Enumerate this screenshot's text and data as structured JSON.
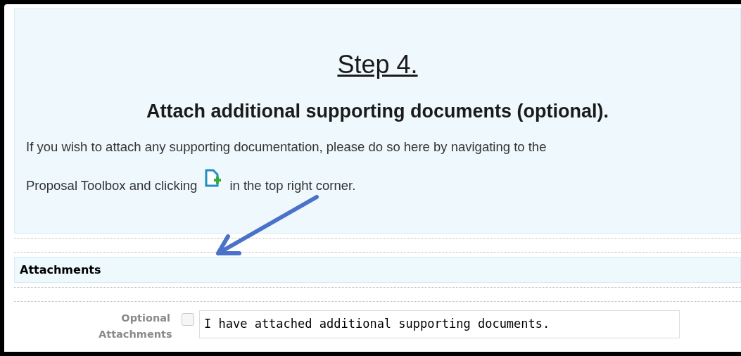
{
  "instructions": {
    "step": "Step 4.",
    "heading": "Attach additional supporting documents (optional).",
    "line_1": "If you wish to attach any supporting documentation, please do so here by navigating to the",
    "line_2_before_icon": "Proposal Toolbox and clicking",
    "line_2_after_icon": "in the top right corner."
  },
  "section": {
    "title": "Attachments"
  },
  "field": {
    "label": "Optional Attachments",
    "checked": false,
    "option_text": "I have attached additional supporting documents."
  }
}
